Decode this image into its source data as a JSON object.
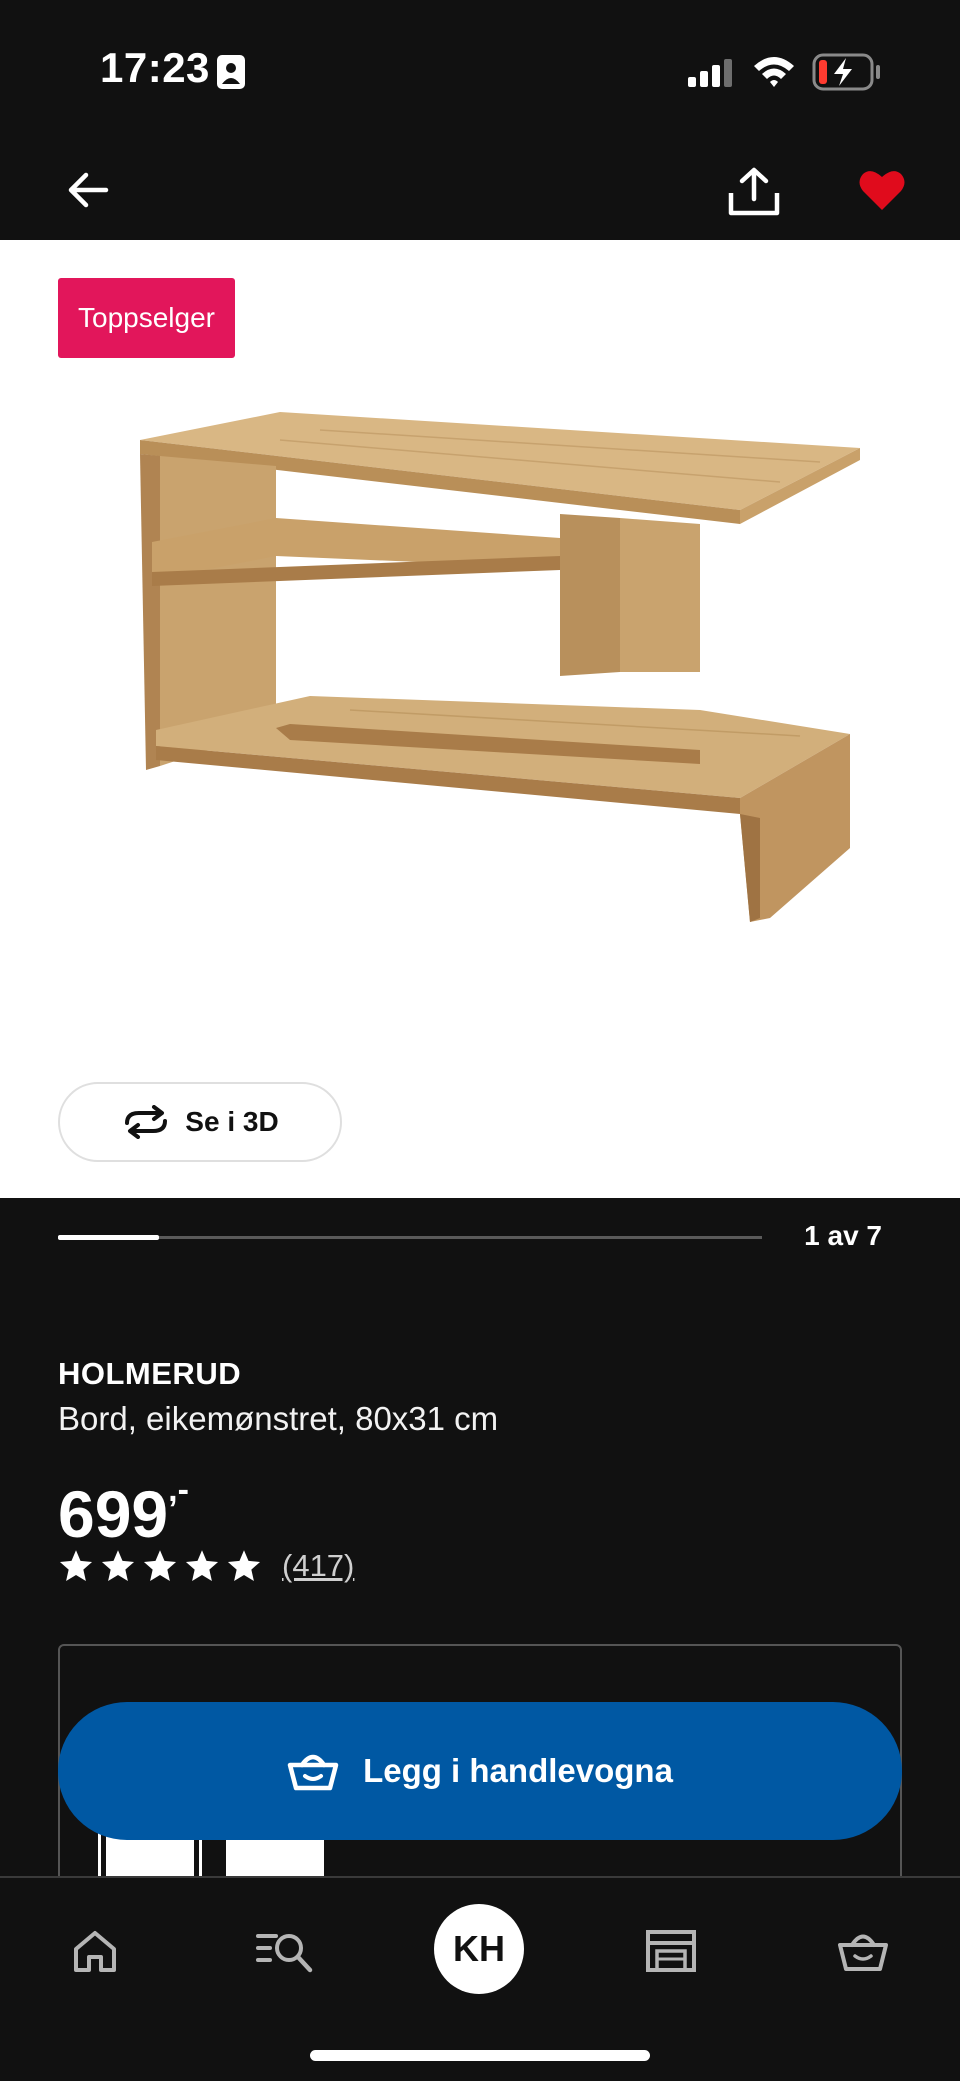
{
  "status_bar": {
    "time": "17:23"
  },
  "product": {
    "badge": "Toppselger",
    "view_3d_label": "Se i 3D",
    "image_counter": "1 av 7",
    "image_progress": 0.143,
    "name": "HOLMERUD",
    "description": "Bord, eikemønstret, 80x31 cm",
    "price": "699",
    "price_suffix": ",-",
    "rating_stars": 5,
    "review_count": "(417)"
  },
  "cart": {
    "add_label": "Legg i handlevogna"
  },
  "bottom_nav": {
    "profile_initials": "KH"
  },
  "colors": {
    "badge": "#e2165b",
    "primary_button": "#0058a3",
    "favorite": "#e00b1c",
    "background": "#111111"
  },
  "icons": [
    "back-arrow-icon",
    "share-icon",
    "heart-icon",
    "rotate-3d-icon",
    "star-icon",
    "cart-icon",
    "home-icon",
    "search-list-icon",
    "store-icon",
    "basket-icon"
  ]
}
